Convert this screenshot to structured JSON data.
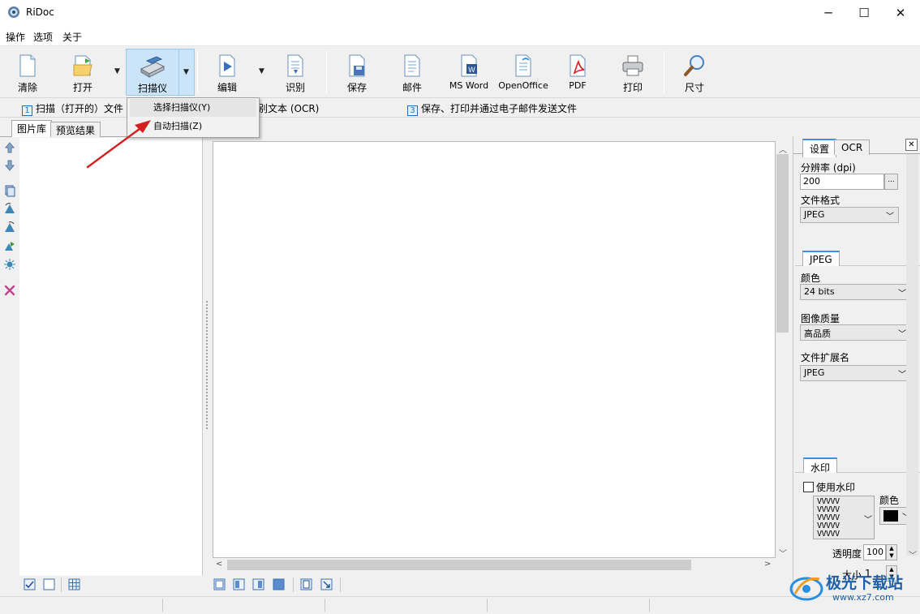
{
  "window": {
    "title": "RiDoc"
  },
  "menu": [
    "操作",
    "选项",
    "关于"
  ],
  "toolbar": {
    "clear": "清除",
    "open": "打开",
    "scanner": "扫描仪",
    "edit": "编辑",
    "recognize": "识别",
    "save": "保存",
    "mail": "邮件",
    "msword": "MS Word",
    "openoffice": "OpenOffice",
    "pdf": "PDF",
    "print": "打印",
    "size": "尺寸"
  },
  "steps": {
    "s1_num": "1",
    "s1": "扫描（打开的）文件",
    "s2": "别文本 (OCR)",
    "s3_num": "3",
    "s3": "保存、打印并通过电子邮件发送文件"
  },
  "dropdown": {
    "items": [
      "选择扫描仪(Y)",
      "自动扫描(Z)"
    ]
  },
  "left_tabs": [
    "图片库",
    "预览结果"
  ],
  "right_panel": {
    "tabs": [
      "设置",
      "OCR"
    ],
    "close": "✕",
    "resolution_label": "分辨率 (dpi)",
    "resolution_value": "200",
    "browse": "...",
    "format_label": "文件格式",
    "format_value": "JPEG",
    "jpeg_tab": "JPEG",
    "color_label": "颜色",
    "color_value": "24 bits",
    "quality_label": "图像质量",
    "quality_value": "高品质",
    "ext_label": "文件扩展名",
    "ext_value": "JPEG",
    "watermark_tab": "水印",
    "use_watermark": "使用水印",
    "wm_color_label": "颜色",
    "wm_pattern": "VVVVV",
    "opacity_label": "透明度",
    "opacity_value": "100",
    "size_label": "大小",
    "size_value": "1"
  },
  "watermark_logo": {
    "name": "极光下载站",
    "url": "www.xz7.com"
  },
  "colors": {
    "accent": "#3c8ee6",
    "selected_btn": "#cce4f7",
    "arrow": "#d42020"
  }
}
